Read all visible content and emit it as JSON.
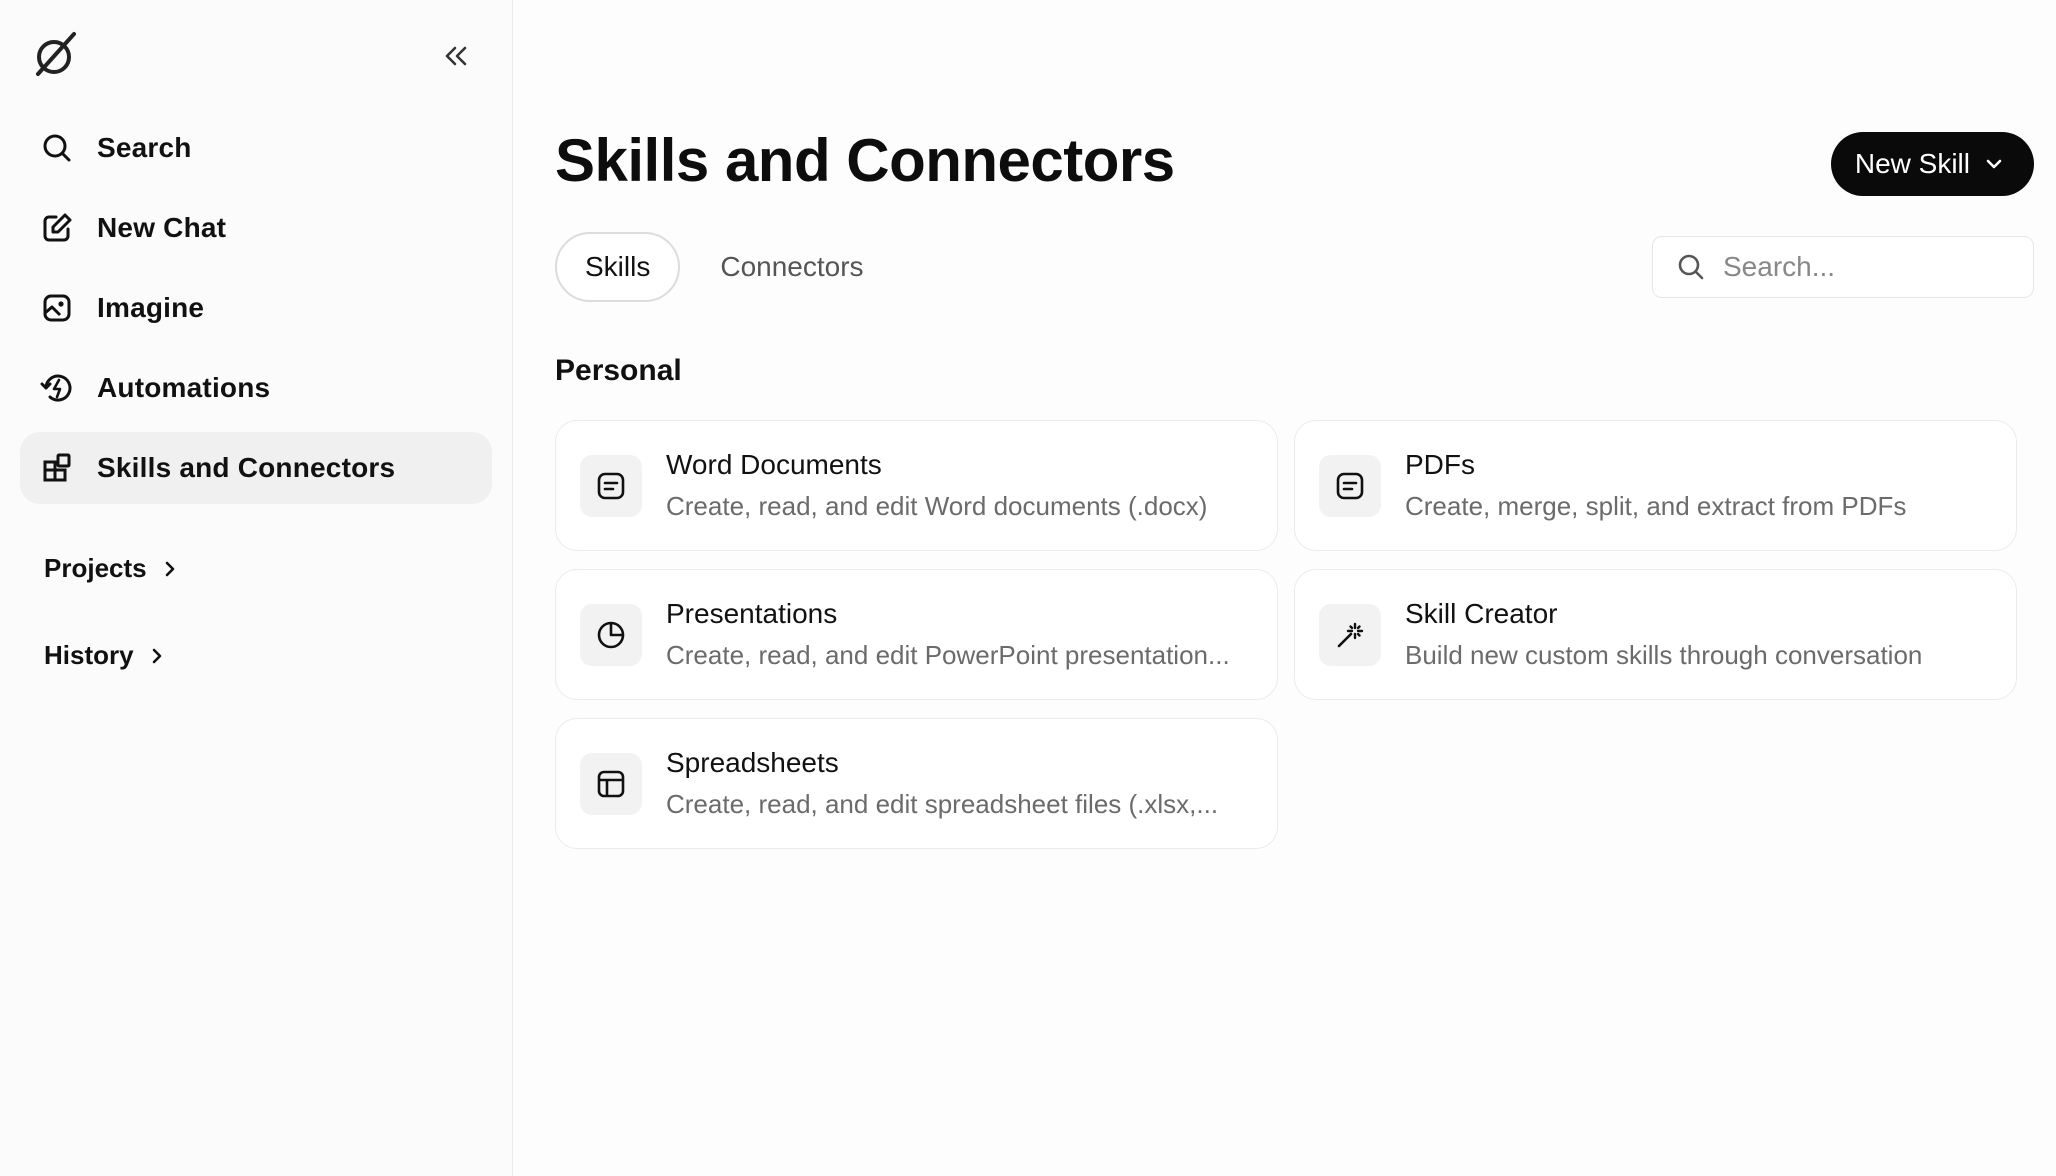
{
  "sidebar": {
    "items": [
      {
        "label": "Search",
        "icon": "search-icon"
      },
      {
        "label": "New Chat",
        "icon": "edit-icon"
      },
      {
        "label": "Imagine",
        "icon": "image-icon"
      },
      {
        "label": "Automations",
        "icon": "history-bolt-icon"
      },
      {
        "label": "Skills and Connectors",
        "icon": "grid-plus-icon",
        "active": true
      }
    ],
    "projects_label": "Projects",
    "history_label": "History"
  },
  "main": {
    "title": "Skills and Connectors",
    "new_skill_label": "New Skill",
    "tabs": [
      {
        "label": "Skills",
        "active": true
      },
      {
        "label": "Connectors",
        "active": false
      }
    ],
    "search": {
      "placeholder": "Search..."
    },
    "section_heading": "Personal",
    "cards": [
      {
        "name": "Word Documents",
        "desc": "Create, read, and edit Word documents (.docx)",
        "icon": "document-icon"
      },
      {
        "name": "PDFs",
        "desc": "Create, merge, split, and extract from PDFs",
        "icon": "document-icon"
      },
      {
        "name": "Presentations",
        "desc": "Create, read, and edit PowerPoint presentation...",
        "icon": "pie-chart-icon"
      },
      {
        "name": "Skill Creator",
        "desc": "Build new custom skills through conversation",
        "icon": "magic-wand-icon"
      },
      {
        "name": "Spreadsheets",
        "desc": "Create, read, and edit spreadsheet files (.xlsx,...",
        "icon": "table-icon"
      }
    ]
  },
  "colors": {
    "accent_button": "#0a0a0a",
    "active_nav": "#f0f0f0",
    "muted_text": "#6b6b6b"
  }
}
